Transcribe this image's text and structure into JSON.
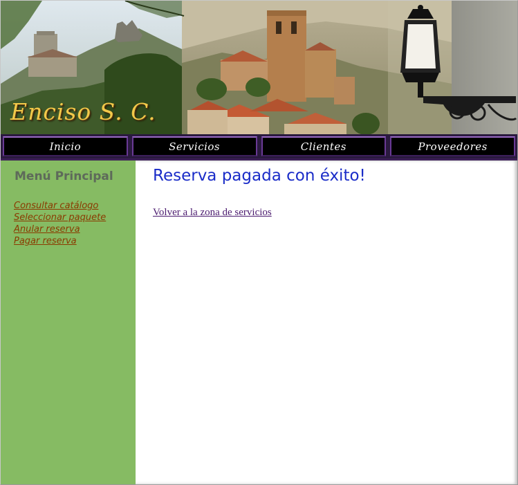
{
  "header": {
    "brand": "Enciso S. C."
  },
  "nav": {
    "items": [
      {
        "label": "Inicio"
      },
      {
        "label": "Servicios"
      },
      {
        "label": "Clientes"
      },
      {
        "label": "Proveedores"
      }
    ]
  },
  "sidebar": {
    "title": "Menú Principal",
    "links": [
      {
        "label": "Consultar catálogo"
      },
      {
        "label": "Seleccionar paquete"
      },
      {
        "label": "Anular reserva"
      },
      {
        "label": "Pagar reserva"
      }
    ]
  },
  "main": {
    "title": "Reserva pagada con éxito!",
    "back_link": "Volver a la zona de servicios"
  },
  "colors": {
    "sidebar_bg": "#86bb63",
    "title_blue": "#1a2cc8",
    "menu_link": "#8a3a00",
    "nav_border": "#6a3a96",
    "brand_gold": "#f2c94a"
  }
}
